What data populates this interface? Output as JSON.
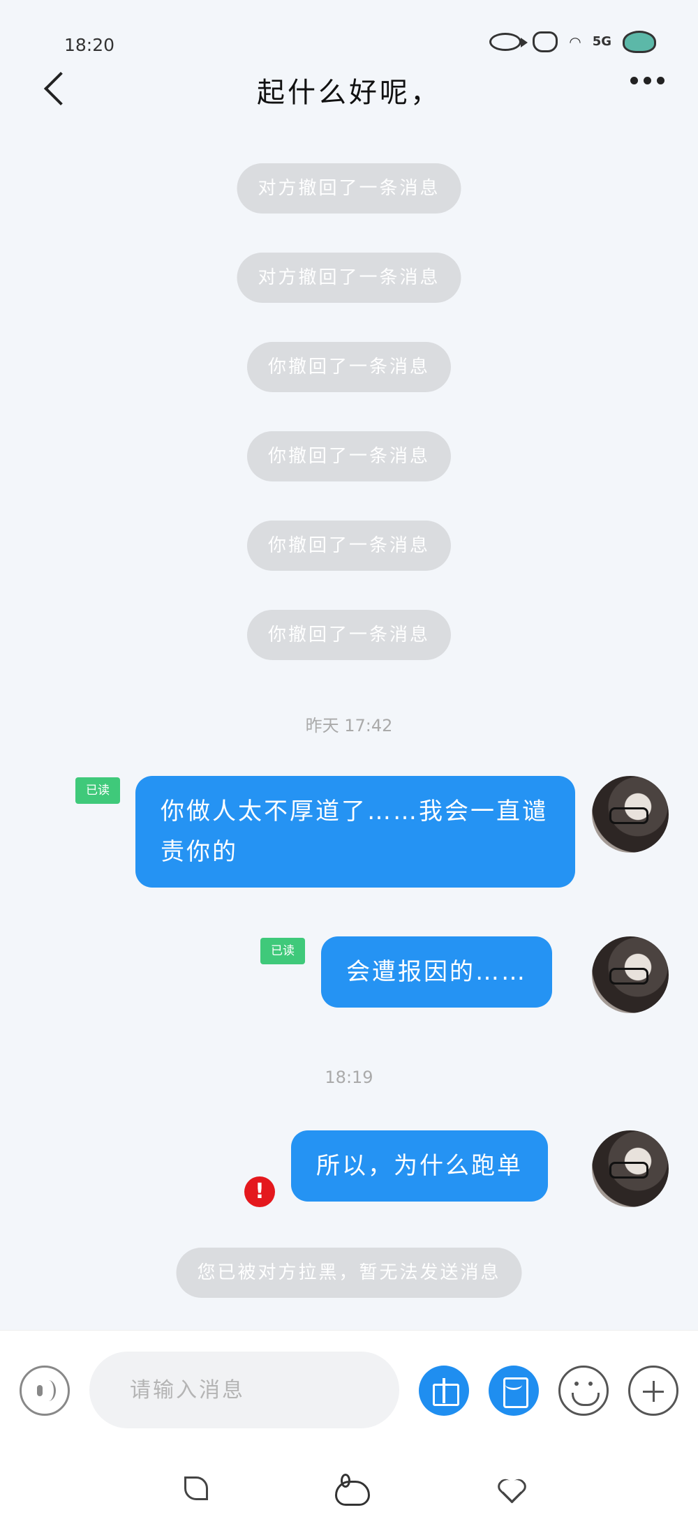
{
  "status_bar": {
    "time": "18:20",
    "network": "5G",
    "icons": [
      "fish-icon",
      "bunny-icon",
      "wifi-icon",
      "signal-icon",
      "battery-icon"
    ]
  },
  "header": {
    "title": "起什么好呢，",
    "back_icon": "chevron-left-icon",
    "more_icon": "more-dots-icon"
  },
  "messages": {
    "recall_1": "对方撤回了一条消息",
    "recall_2": "对方撤回了一条消息",
    "recall_3": "你撤回了一条消息",
    "recall_4": "你撤回了一条消息",
    "recall_5": "你撤回了一条消息",
    "recall_6": "你撤回了一条消息",
    "timestamp_1": "昨天 17:42",
    "msg_1": "你做人太不厚道了……我会一直谴责你的",
    "msg_1_status": "已读",
    "msg_2": "会遭报因的……",
    "msg_2_status": "已读",
    "timestamp_2": "18:19",
    "msg_3": "所以，为什么跑单",
    "msg_3_error": "!",
    "blocked_notice": "您已被对方拉黑，暂无法发送消息"
  },
  "input_bar": {
    "placeholder": "请输入消息",
    "buttons": [
      "voice-icon",
      "gift-icon",
      "envelope-icon",
      "emoji-icon",
      "plus-icon"
    ]
  },
  "bottom_nav": {
    "icons": [
      "leaf-icon",
      "bunny-icon",
      "heart-icon"
    ]
  },
  "colors": {
    "bubble": "#2593f3",
    "read_badge": "#3fc97a",
    "error": "#e4181d",
    "recall_pill": "#dadcdf"
  }
}
